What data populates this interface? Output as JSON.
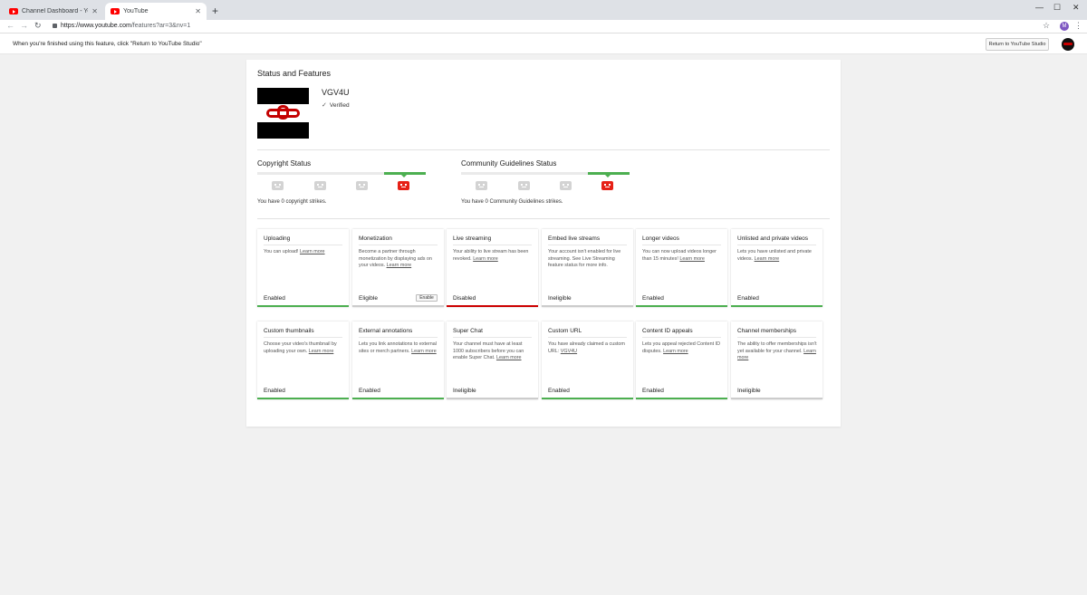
{
  "browser": {
    "tabs": [
      {
        "title": "Channel Dashboard - YouTube S",
        "active": false
      },
      {
        "title": "YouTube",
        "active": true
      }
    ],
    "new_tab": "+",
    "url_host": "https://www.youtube.com",
    "url_path": "/features?ar=3&nv=1",
    "profile_initial": "M",
    "back": "←",
    "forward": "→",
    "reload": "↻",
    "star": "☆",
    "menu": "⋮",
    "minimize": "—",
    "maximize": "☐",
    "close": "✕"
  },
  "notice": {
    "text": "When you're finished using this feature, click \"Return to YouTube Studio\"",
    "button": "Return to YouTube Studio"
  },
  "panel": {
    "title": "Status and Features",
    "channel_name": "VGV4U",
    "verified": "Verified"
  },
  "copyright": {
    "title": "Copyright Status",
    "strikes": "You have 0 copyright strikes."
  },
  "community": {
    "title": "Community Guidelines Status",
    "strikes": "You have 0 Community Guidelines strikes."
  },
  "features": [
    {
      "title": "Uploading",
      "desc": "You can upload!",
      "link": "Learn more",
      "status": "Enabled",
      "bar": "green"
    },
    {
      "title": "Monetization",
      "desc": "Become a partner through monetization by displaying ads on your videos.",
      "link": "Learn more",
      "status": "Eligible",
      "bar": "gray",
      "button": "Enable"
    },
    {
      "title": "Live streaming",
      "desc": "Your ability to live stream has been revoked.",
      "link": "Learn more",
      "status": "Disabled",
      "bar": "red"
    },
    {
      "title": "Embed live streams",
      "desc": "Your account isn't enabled for live streaming. See Live Streaming feature status for more info.",
      "link": "",
      "status": "Ineligible",
      "bar": "gray"
    },
    {
      "title": "Longer videos",
      "desc": "You can now upload videos longer than 15 minutes!",
      "link": "Learn more",
      "status": "Enabled",
      "bar": "green"
    },
    {
      "title": "Unlisted and private videos",
      "desc": "Lets you have unlisted and private videos.",
      "link": "Learn more",
      "status": "Enabled",
      "bar": "green"
    },
    {
      "title": "Custom thumbnails",
      "desc": "Choose your video's thumbnail by uploading your own.",
      "link": "Learn more",
      "status": "Enabled",
      "bar": "green"
    },
    {
      "title": "External annotations",
      "desc": "Lets you link annotations to external sites or merch partners.",
      "link": "Learn more",
      "status": "Enabled",
      "bar": "green"
    },
    {
      "title": "Super Chat",
      "desc": "Your channel must have at least 1000 subscribers before you can enable Super Chat.",
      "link": "Learn more",
      "status": "Ineligible",
      "bar": "gray"
    },
    {
      "title": "Custom URL",
      "desc": "You have already claimed a custom URL:",
      "link": "VGV4U",
      "status": "Enabled",
      "bar": "green"
    },
    {
      "title": "Content ID appeals",
      "desc": "Lets you appeal rejected Content ID disputes.",
      "link": "Learn more",
      "status": "Enabled",
      "bar": "green"
    },
    {
      "title": "Channel memberships",
      "desc": "The ability to offer memberships isn't yet available for your channel.",
      "link": "Learn more",
      "status": "Ineligible",
      "bar": "gray"
    }
  ]
}
